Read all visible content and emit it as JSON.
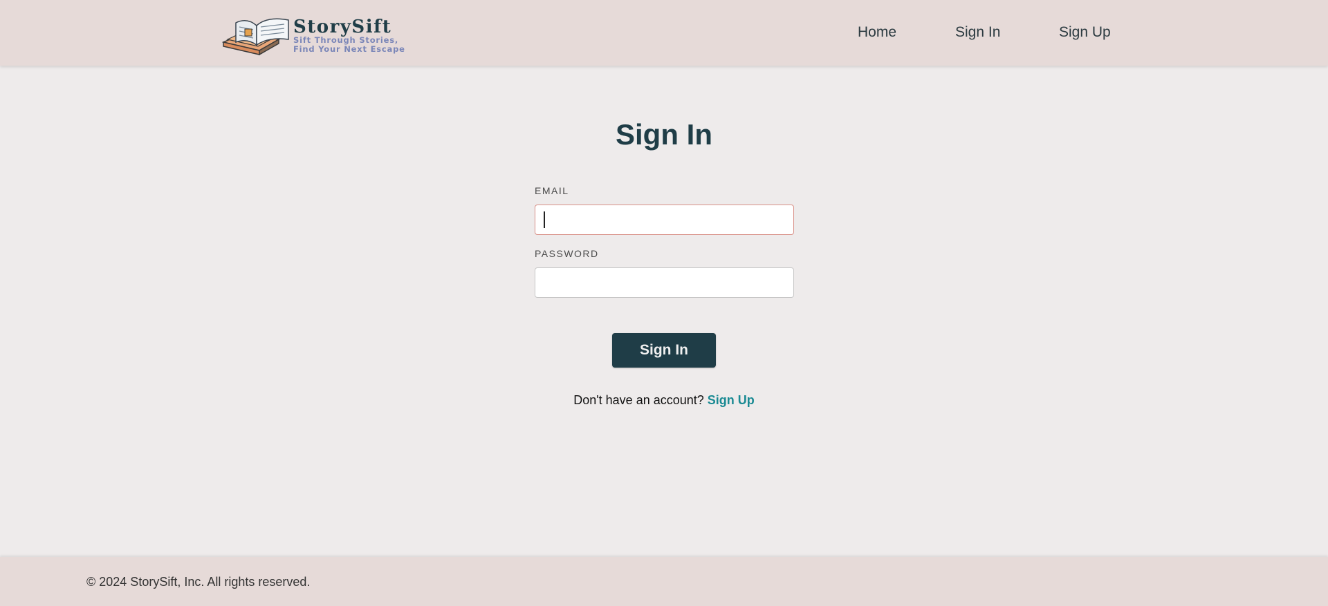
{
  "header": {
    "brand_name": "StorySift",
    "brand_tagline_line1": "Sift Through Stories,",
    "brand_tagline_line2": "Find Your Next Escape",
    "nav": [
      {
        "label": "Home"
      },
      {
        "label": "Sign In"
      },
      {
        "label": "Sign Up"
      }
    ]
  },
  "main": {
    "title": "Sign In",
    "email": {
      "label": "EMAIL",
      "value": "",
      "placeholder": ""
    },
    "password": {
      "label": "PASSWORD",
      "value": "",
      "placeholder": ""
    },
    "submit_label": "Sign In",
    "signup_prompt": "Don't have an account?",
    "signup_link": "Sign Up"
  },
  "footer": {
    "copyright": "© 2024 StorySift, Inc. All rights reserved."
  },
  "colors": {
    "header_bg": "#e6dad8",
    "page_bg": "#eeebeb",
    "primary": "#1f3d47",
    "link": "#1a8a93",
    "focus_border": "#d88f86"
  },
  "icons": {
    "logo": "open-book-logo-icon"
  }
}
